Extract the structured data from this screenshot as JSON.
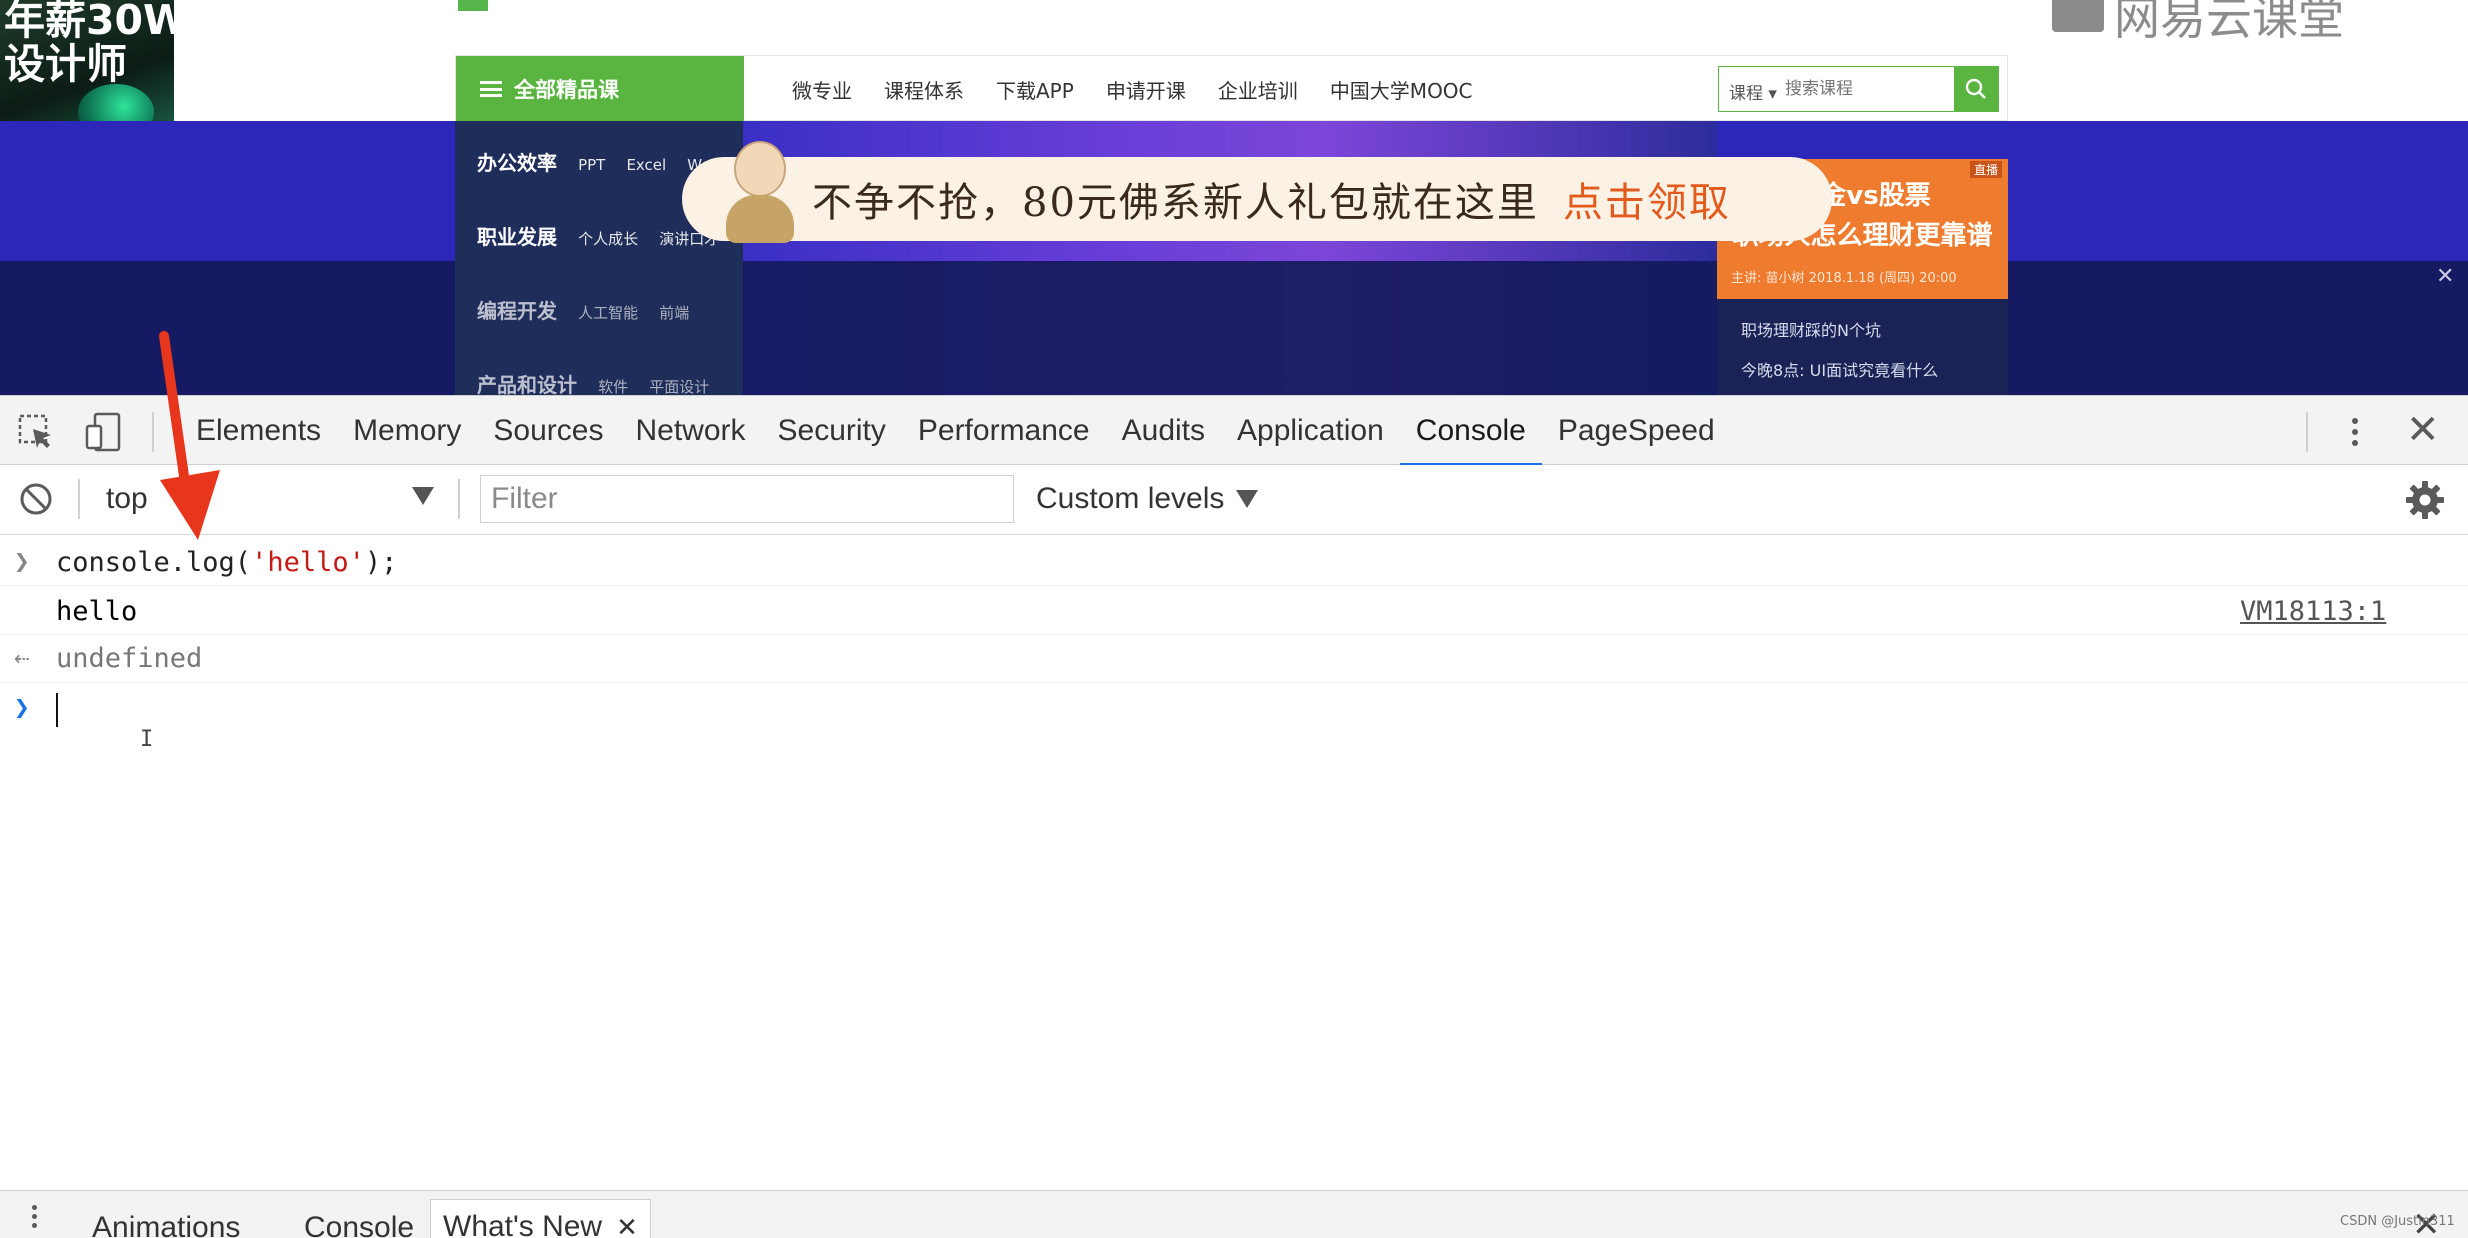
{
  "website": {
    "corner_ad": {
      "line1": "年薪30W",
      "line2": "设计师"
    },
    "logo_right": "网易云课堂",
    "nav": {
      "all_courses": "全部精品课",
      "links": [
        "微专业",
        "课程体系",
        "下载APP",
        "申请开课",
        "企业培训",
        "中国大学MOOC"
      ],
      "search_category": "课程 ▾",
      "search_placeholder": "搜索课程"
    },
    "categories": [
      {
        "main": "办公效率",
        "subs": [
          "PPT",
          "Excel",
          "Word"
        ]
      },
      {
        "main": "职业发展",
        "subs": [
          "个人成长",
          "演讲口才"
        ]
      },
      {
        "main": "编程开发",
        "subs": [
          "人工智能",
          "前端"
        ]
      },
      {
        "main": "产品和设计",
        "subs": [
          "软件",
          "平面设计"
        ]
      }
    ],
    "side_card": {
      "tag": "直播",
      "title1": "基金vs股票",
      "title2": "职场人怎么理财更靠谱",
      "meta": "主讲: 苗小树  2018.1.18 (周四) 20:00",
      "item1": "职场理财踩的N个坑",
      "item2": "今晚8点: UI面试究竟看什么"
    },
    "promo": {
      "text": "不争不抢，80元佛系新人礼包就在这里",
      "cta": "点击领取"
    }
  },
  "devtools": {
    "tabs": [
      "Elements",
      "Memory",
      "Sources",
      "Network",
      "Security",
      "Performance",
      "Audits",
      "Application",
      "Console",
      "PageSpeed"
    ],
    "active_tab": "Console",
    "toolbar": {
      "context": "top",
      "filter_placeholder": "Filter",
      "levels": "Custom levels"
    },
    "console": {
      "input_prefix": "console.log(",
      "input_string": "'hello'",
      "input_suffix": ");",
      "log_output": "hello",
      "log_source": "VM18113:1",
      "return_value": "undefined"
    },
    "drawer": {
      "tabs": [
        "Animations",
        "Console",
        "What's New"
      ],
      "selected": "What's New"
    }
  },
  "watermark": "CSDN @Justin311",
  "colors": {
    "accent": "#1a73e8",
    "brand_green": "#59b540",
    "arrow": "#e8361d",
    "string": "#c41a16"
  }
}
